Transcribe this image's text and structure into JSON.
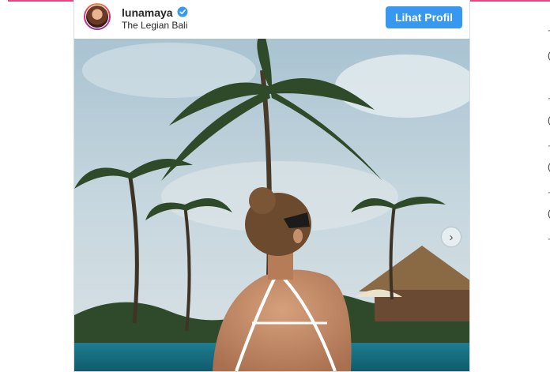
{
  "embed": {
    "username": "lunamaya",
    "location": "The Legian Bali",
    "profile_button": "Lihat Profil",
    "next_icon": "chevron-right-icon"
  },
  "colors": {
    "accent": "#e8457a",
    "button_blue": "#3897f0",
    "verified_blue": "#3897f0"
  }
}
